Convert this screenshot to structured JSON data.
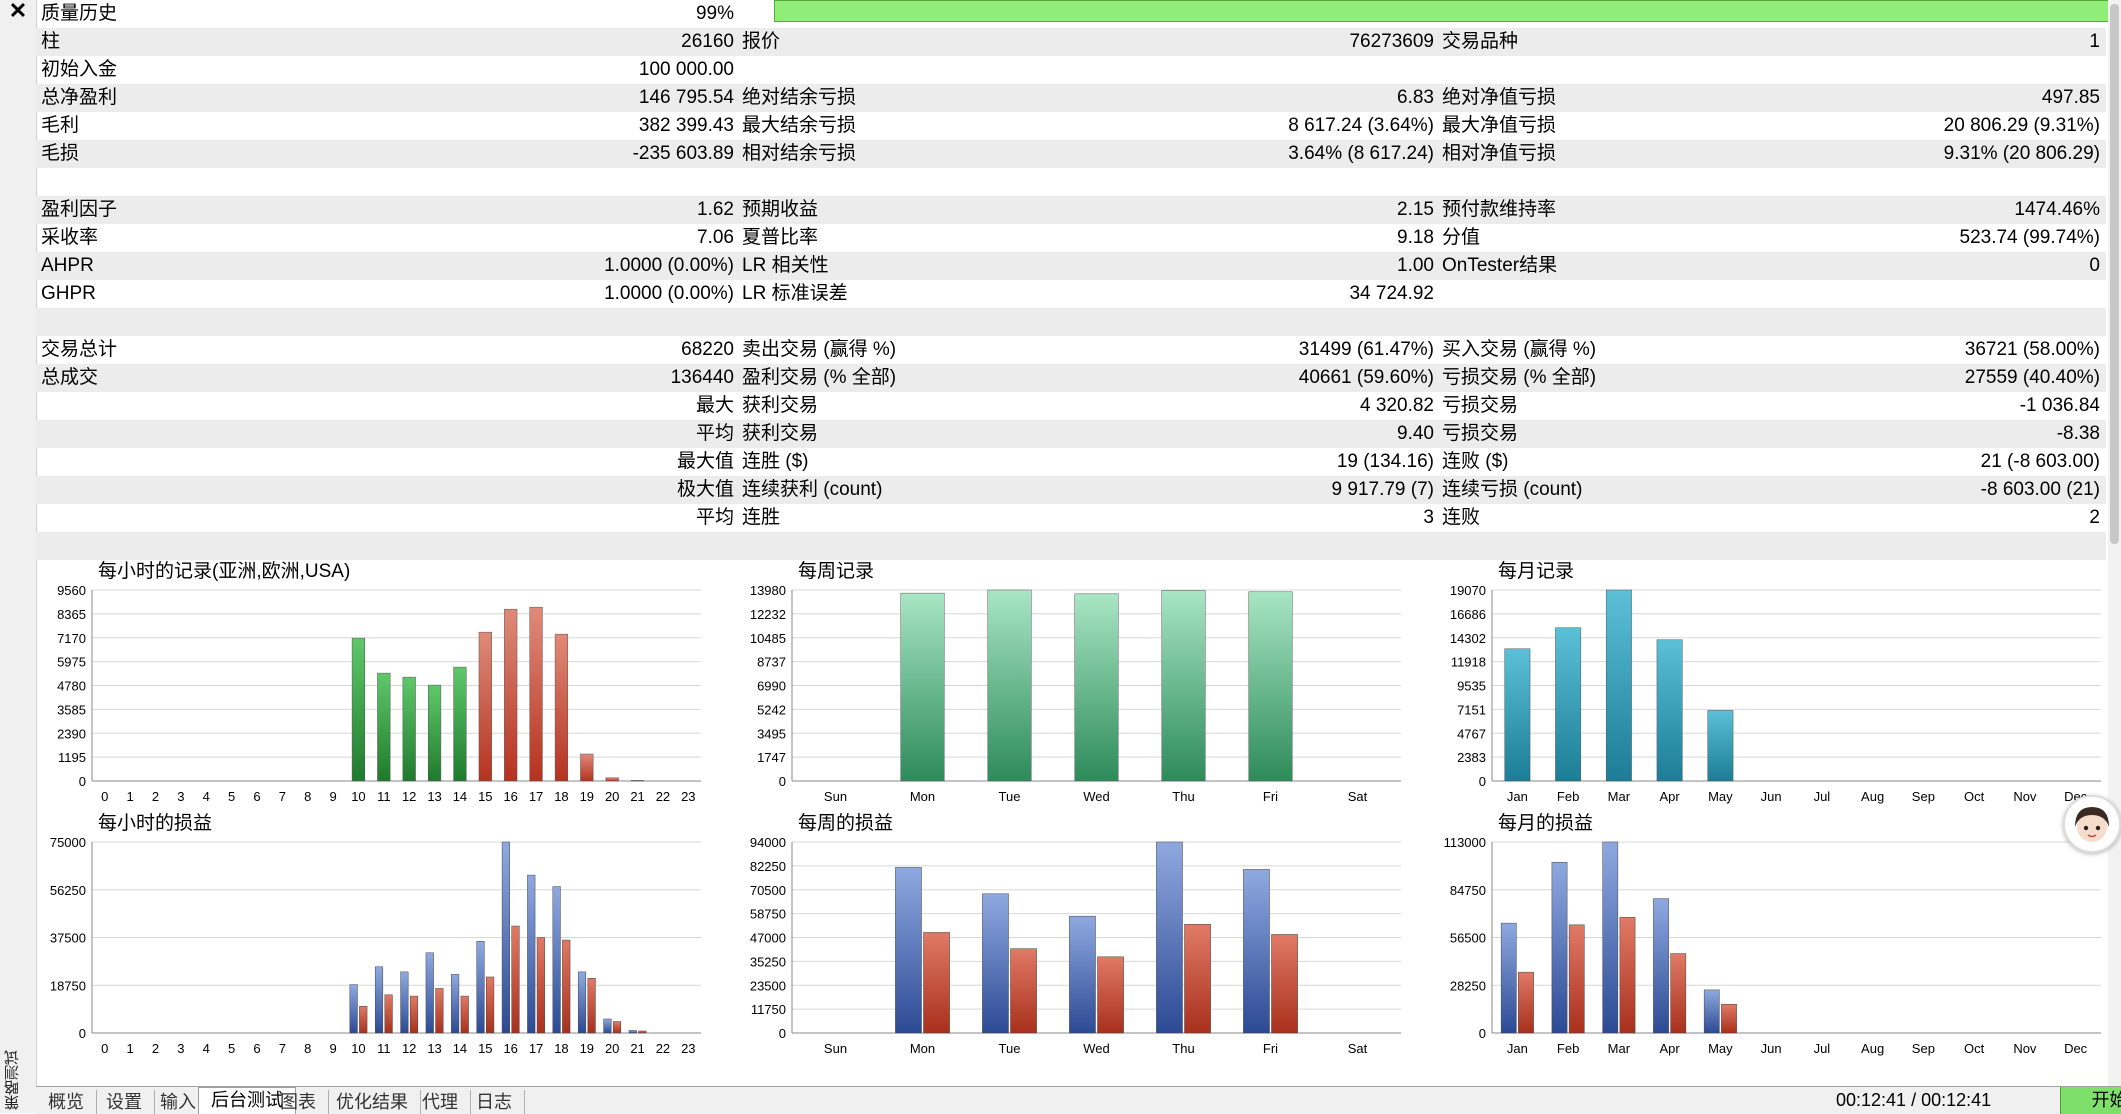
{
  "window": {
    "close_symbol": "✕",
    "side_label": "策略测试"
  },
  "stats": {
    "quality": {
      "label": "质量历史",
      "value": "99%"
    },
    "rows": [
      {
        "shade": true,
        "c": [
          [
            "柱",
            "26160"
          ],
          [
            "报价",
            "76273609"
          ],
          [
            "交易品种",
            "1"
          ]
        ]
      },
      {
        "shade": false,
        "c": [
          [
            "初始入金",
            "100 000.00"
          ],
          [
            "",
            ""
          ],
          [
            "",
            ""
          ]
        ]
      },
      {
        "shade": true,
        "c": [
          [
            "总净盈利",
            "146 795.54"
          ],
          [
            "绝对结余亏损",
            "6.83"
          ],
          [
            "绝对净值亏损",
            "497.85"
          ]
        ]
      },
      {
        "shade": false,
        "c": [
          [
            "毛利",
            "382 399.43"
          ],
          [
            "最大结余亏损",
            "8 617.24 (3.64%)"
          ],
          [
            "最大净值亏损",
            "20 806.29 (9.31%)"
          ]
        ]
      },
      {
        "shade": true,
        "c": [
          [
            "毛损",
            "-235 603.89"
          ],
          [
            "相对结余亏损",
            "3.64% (8 617.24)"
          ],
          [
            "相对净值亏损",
            "9.31% (20 806.29)"
          ]
        ]
      },
      {
        "shade": false,
        "c": [
          [
            "",
            ""
          ],
          [
            "",
            ""
          ],
          [
            "",
            ""
          ]
        ]
      },
      {
        "shade": true,
        "c": [
          [
            "盈利因子",
            "1.62"
          ],
          [
            "预期收益",
            "2.15"
          ],
          [
            "预付款维持率",
            "1474.46%"
          ]
        ]
      },
      {
        "shade": false,
        "c": [
          [
            "采收率",
            "7.06"
          ],
          [
            "夏普比率",
            "9.18"
          ],
          [
            "分值",
            "523.74 (99.74%)"
          ]
        ]
      },
      {
        "shade": true,
        "c": [
          [
            "AHPR",
            "1.0000 (0.00%)"
          ],
          [
            "LR 相关性",
            "1.00"
          ],
          [
            "OnTester结果",
            "0"
          ]
        ]
      },
      {
        "shade": false,
        "c": [
          [
            "GHPR",
            "1.0000 (0.00%)"
          ],
          [
            "LR 标准误差",
            "34 724.92"
          ],
          [
            "",
            ""
          ]
        ]
      },
      {
        "shade": true,
        "c": [
          [
            "",
            ""
          ],
          [
            "",
            ""
          ],
          [
            "",
            ""
          ]
        ]
      },
      {
        "shade": false,
        "c": [
          [
            "交易总计",
            "68220"
          ],
          [
            "卖出交易 (赢得 %)",
            "31499 (61.47%)"
          ],
          [
            "买入交易 (赢得 %)",
            "36721 (58.00%)"
          ]
        ]
      },
      {
        "shade": true,
        "c": [
          [
            "总成交",
            "136440"
          ],
          [
            "盈利交易 (% 全部)",
            "40661 (59.60%)"
          ],
          [
            "亏损交易 (% 全部)",
            "27559 (40.40%)"
          ]
        ]
      },
      {
        "shade": false,
        "c": [
          [
            "",
            "最大"
          ],
          [
            "获利交易",
            "4 320.82"
          ],
          [
            "亏损交易",
            "-1 036.84"
          ]
        ]
      },
      {
        "shade": true,
        "c": [
          [
            "",
            "平均"
          ],
          [
            "获利交易",
            "9.40"
          ],
          [
            "亏损交易",
            "-8.38"
          ]
        ]
      },
      {
        "shade": false,
        "c": [
          [
            "",
            "最大值"
          ],
          [
            "连胜 ($)",
            "19 (134.16)"
          ],
          [
            "连败 ($)",
            "21 (-8 603.00)"
          ]
        ]
      },
      {
        "shade": true,
        "c": [
          [
            "",
            "极大值"
          ],
          [
            "连续获利 (count)",
            "9 917.79 (7)"
          ],
          [
            "连续亏损 (count)",
            "-8 603.00 (21)"
          ]
        ]
      },
      {
        "shade": false,
        "c": [
          [
            "",
            "平均"
          ],
          [
            "连胜",
            "3"
          ],
          [
            "连败",
            "2"
          ]
        ]
      },
      {
        "shade": true,
        "c": [
          [
            "",
            ""
          ],
          [
            "",
            ""
          ],
          [
            "",
            ""
          ]
        ]
      }
    ]
  },
  "colors": {
    "green": "#2e8b3a",
    "red": "#c0392b",
    "blue": "#3d5fa8",
    "teal": "#1f8fa8",
    "quality_bar": "#90ee78"
  },
  "chart_data": [
    {
      "id": "hourly-entries",
      "type": "bar",
      "title": "每小时的记录(亚洲,欧洲,USA)",
      "categories": [
        "0",
        "1",
        "2",
        "3",
        "4",
        "5",
        "6",
        "7",
        "8",
        "9",
        "10",
        "11",
        "12",
        "13",
        "14",
        "15",
        "16",
        "17",
        "18",
        "19",
        "20",
        "21",
        "22",
        "23"
      ],
      "values": [
        0,
        0,
        0,
        0,
        0,
        0,
        0,
        0,
        0,
        0,
        7150,
        5400,
        5200,
        4800,
        5700,
        7450,
        8600,
        8700,
        7350,
        1350,
        160,
        30,
        0,
        0
      ],
      "yticks": [
        0,
        1195,
        2390,
        3585,
        4780,
        5975,
        7170,
        8365,
        9560
      ],
      "ylim": [
        0,
        9560
      ]
    },
    {
      "id": "weekly-entries",
      "type": "bar",
      "title": "每周记录",
      "categories": [
        "Sun",
        "Mon",
        "Tue",
        "Wed",
        "Thu",
        "Fri",
        "Sat"
      ],
      "values": [
        0,
        13750,
        13980,
        13700,
        13950,
        13850,
        0
      ],
      "yticks": [
        0,
        1747,
        3495,
        5242,
        6990,
        8737,
        10485,
        12232,
        13980
      ],
      "ylim": [
        0,
        13980
      ]
    },
    {
      "id": "monthly-entries",
      "type": "bar",
      "title": "每月记录",
      "categories": [
        "Jan",
        "Feb",
        "Mar",
        "Apr",
        "May",
        "Jun",
        "Jul",
        "Aug",
        "Sep",
        "Oct",
        "Nov",
        "Dec"
      ],
      "values": [
        13200,
        15300,
        19070,
        14100,
        7050,
        0,
        0,
        0,
        0,
        0,
        0,
        0
      ],
      "yticks": [
        0,
        2383,
        4767,
        7151,
        9535,
        11918,
        14302,
        16686,
        19070
      ],
      "ylim": [
        0,
        19070
      ]
    },
    {
      "id": "hourly-profit",
      "type": "bar",
      "title": "每小时的损益",
      "categories": [
        "0",
        "1",
        "2",
        "3",
        "4",
        "5",
        "6",
        "7",
        "8",
        "9",
        "10",
        "11",
        "12",
        "13",
        "14",
        "15",
        "16",
        "17",
        "18",
        "19",
        "20",
        "21",
        "22",
        "23"
      ],
      "series": [
        {
          "values": [
            0,
            0,
            0,
            0,
            0,
            0,
            0,
            0,
            0,
            0,
            19000,
            26000,
            24000,
            31500,
            23000,
            36000,
            75000,
            62000,
            57500,
            24000,
            5500,
            1000,
            0,
            0
          ]
        },
        {
          "values": [
            0,
            0,
            0,
            0,
            0,
            0,
            0,
            0,
            0,
            0,
            10500,
            15000,
            14500,
            17500,
            14500,
            22000,
            42000,
            37500,
            36500,
            21500,
            4500,
            800,
            0,
            0
          ]
        }
      ],
      "yticks": [
        0,
        18750,
        37500,
        56250,
        75000
      ],
      "ylim": [
        0,
        75000
      ]
    },
    {
      "id": "weekly-profit",
      "type": "bar",
      "title": "每周的损益",
      "categories": [
        "Sun",
        "Mon",
        "Tue",
        "Wed",
        "Thu",
        "Fri",
        "Sat"
      ],
      "series": [
        {
          "values": [
            0,
            81500,
            68500,
            57500,
            94000,
            80500,
            0
          ]
        },
        {
          "values": [
            0,
            49500,
            41500,
            37500,
            53500,
            48500,
            0
          ]
        }
      ],
      "yticks": [
        0,
        11750,
        23500,
        35250,
        47000,
        58750,
        70500,
        82250,
        94000
      ],
      "ylim": [
        0,
        94000
      ]
    },
    {
      "id": "monthly-profit",
      "type": "bar",
      "title": "每月的损益",
      "categories": [
        "Jan",
        "Feb",
        "Mar",
        "Apr",
        "May",
        "Jun",
        "Jul",
        "Aug",
        "Sep",
        "Oct",
        "Nov",
        "Dec"
      ],
      "series": [
        {
          "values": [
            65000,
            101000,
            113000,
            79500,
            25500,
            0,
            0,
            0,
            0,
            0,
            0,
            0
          ]
        },
        {
          "values": [
            36000,
            64000,
            68500,
            47000,
            17000,
            0,
            0,
            0,
            0,
            0,
            0,
            0
          ]
        }
      ],
      "yticks": [
        0,
        28250,
        56500,
        84750,
        113000
      ],
      "ylim": [
        0,
        113000
      ]
    }
  ],
  "tabs": [
    "概览",
    "设置",
    "输入",
    "后台测试",
    "图表",
    "优化结果",
    "代理",
    "日志"
  ],
  "active_tab": "后台测试",
  "status": {
    "timer": "00:12:41 / 00:12:41",
    "start_label": "开始"
  }
}
